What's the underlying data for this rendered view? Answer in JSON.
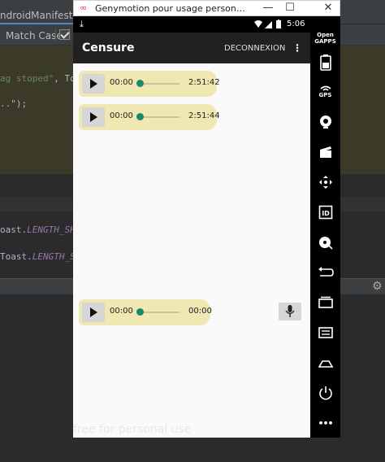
{
  "ide": {
    "tab_label": "ndroidManifest.xm",
    "match_case_label": "Match Case",
    "code_line1_str": "ag stoped\"",
    "code_line1_rest": ", Toa",
    "code_line2": "..\");",
    "code_line3_prefix": "oast.",
    "code_line3_field": "LENGTH_SHO",
    "code_line4_prefix": "Toast.",
    "code_line4_field": "LENGTH_S",
    "gear_icon_glyph": "⚙"
  },
  "window": {
    "title": "Genymotion pour usage personne...",
    "logo_glyph": "∞",
    "minimize_glyph": "—",
    "maximize_glyph": "☐",
    "close_glyph": "✕"
  },
  "status_bar": {
    "time": "5:06",
    "download_glyph": "⤓"
  },
  "app_bar": {
    "title": "Censure",
    "action_label": "DECONNEXION",
    "overflow_glyph": "⋮"
  },
  "players": [
    {
      "current": "00:00",
      "total": "2:51:42",
      "progress": 0
    },
    {
      "current": "00:00",
      "total": "2:51:44",
      "progress": 0
    },
    {
      "current": "00:00",
      "total": "00:00",
      "progress": 0
    }
  ],
  "watermark": "free for personal use",
  "sidebar": {
    "opengapps_line1": "Open",
    "opengapps_line2": "GAPPS",
    "gps_label": "GPS",
    "id_label": "ID",
    "more_glyph": "•••"
  },
  "colors": {
    "player_bg": "#efe8b3",
    "seek_thumb": "#1b8a6b",
    "app_bar": "#212121",
    "ide_editor_highlight": "#3b3a29"
  }
}
